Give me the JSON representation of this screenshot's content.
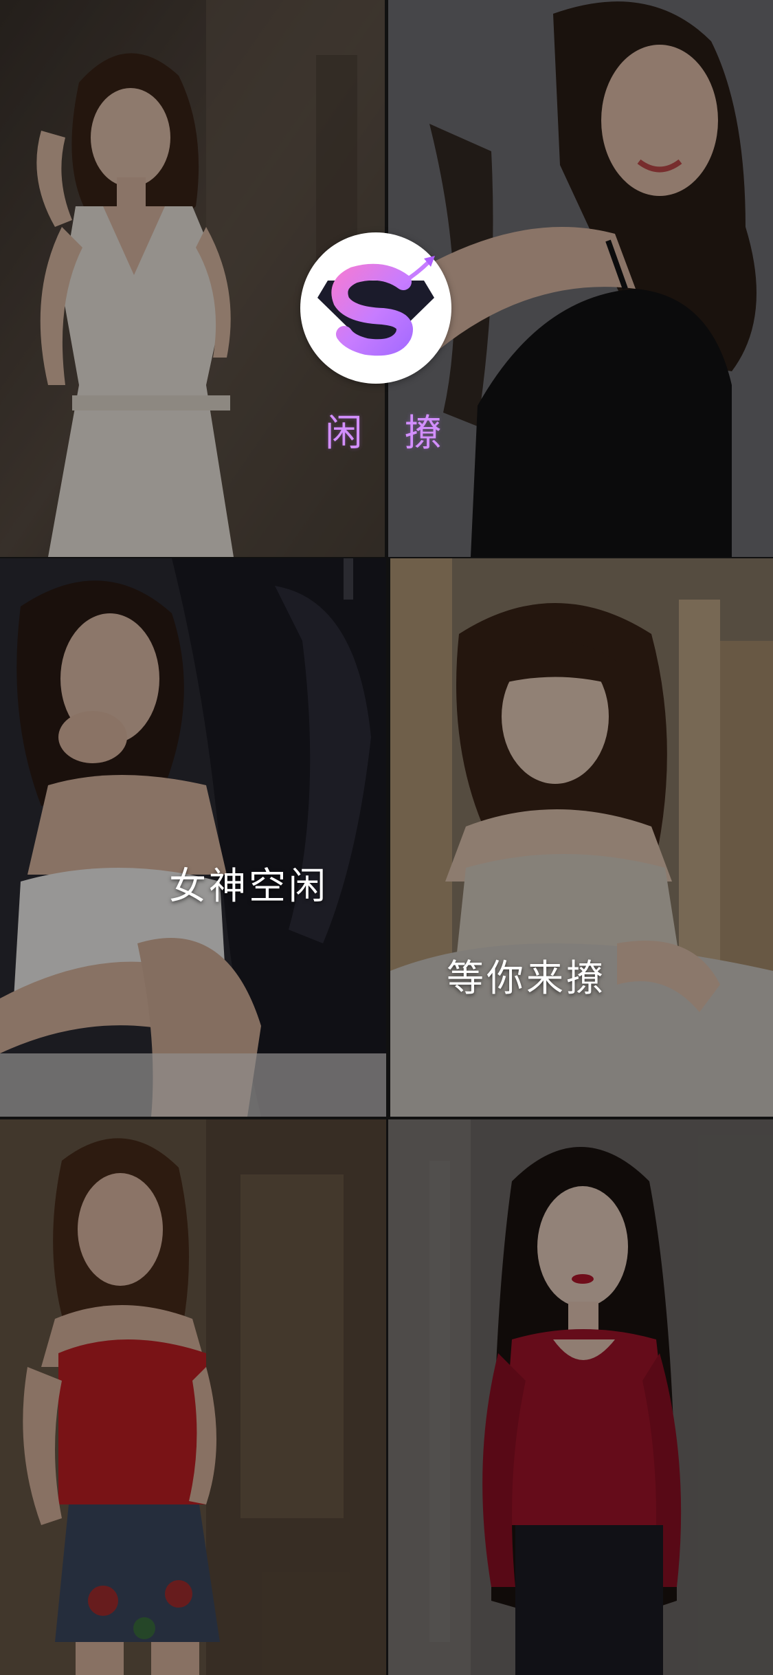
{
  "app": {
    "name": "闲 撩",
    "logo_icon": "superman-s-logo-icon"
  },
  "slogans": {
    "line1": "女神空闲",
    "line2": "等你来撩"
  },
  "photos": [
    {
      "id": "photo-1",
      "subject": "woman-white-dress-icon"
    },
    {
      "id": "photo-2",
      "subject": "woman-black-top-icon"
    },
    {
      "id": "photo-3",
      "subject": "woman-white-top-car-seat-icon"
    },
    {
      "id": "photo-4",
      "subject": "woman-beige-camisole-icon"
    },
    {
      "id": "photo-5",
      "subject": "woman-red-top-denim-shorts-icon"
    },
    {
      "id": "photo-6",
      "subject": "woman-red-sweater-long-hair-icon"
    }
  ],
  "colors": {
    "brand": "#d38fff",
    "logo_pink": "#f07bd8",
    "logo_purple": "#a96dff",
    "logo_dark": "#1b1b2b",
    "logo_background": "#ffffff",
    "slogan_text": "#ffffff"
  }
}
